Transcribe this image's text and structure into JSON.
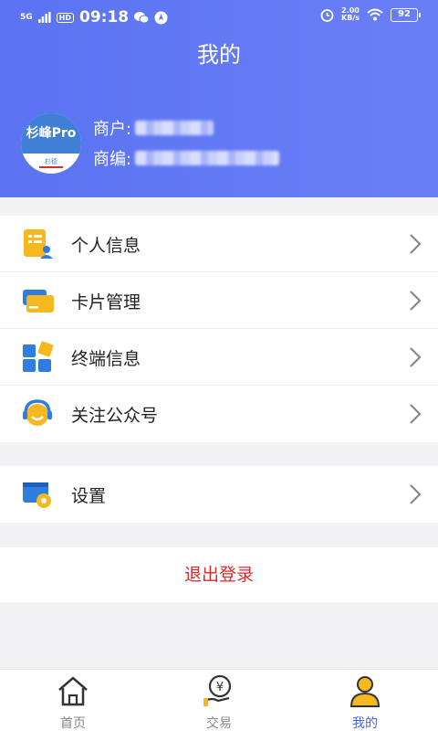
{
  "status_bar": {
    "network": "5G",
    "hd": "HD",
    "time": "09:18",
    "speed_value": "2.00",
    "speed_unit": "KB/s",
    "battery": "92"
  },
  "header": {
    "title": "我的",
    "avatar_text": "杉峰Pro",
    "avatar_subtext": "杉德",
    "merchant_label": "商户:",
    "merchant_code_label": "商编:"
  },
  "menu_group_1": [
    {
      "label": "个人信息",
      "icon": "id-card-icon"
    },
    {
      "label": "卡片管理",
      "icon": "cards-icon"
    },
    {
      "label": "终端信息",
      "icon": "terminal-grid-icon"
    },
    {
      "label": "关注公众号",
      "icon": "headset-icon"
    }
  ],
  "menu_group_2": [
    {
      "label": "设置",
      "icon": "settings-gear-icon"
    }
  ],
  "logout_label": "退出登录",
  "tabs": [
    {
      "label": "首页",
      "icon": "home-icon"
    },
    {
      "label": "交易",
      "icon": "yen-hand-icon"
    },
    {
      "label": "我的",
      "icon": "user-icon"
    }
  ],
  "colors": {
    "header_gradient_start": "#5b73f2",
    "header_gradient_end": "#6a7ff6",
    "logout_red": "#d62a2a",
    "active_tab": "#4a63f0",
    "icon_yellow": "#f6b81f",
    "icon_blue": "#2f7de1"
  }
}
